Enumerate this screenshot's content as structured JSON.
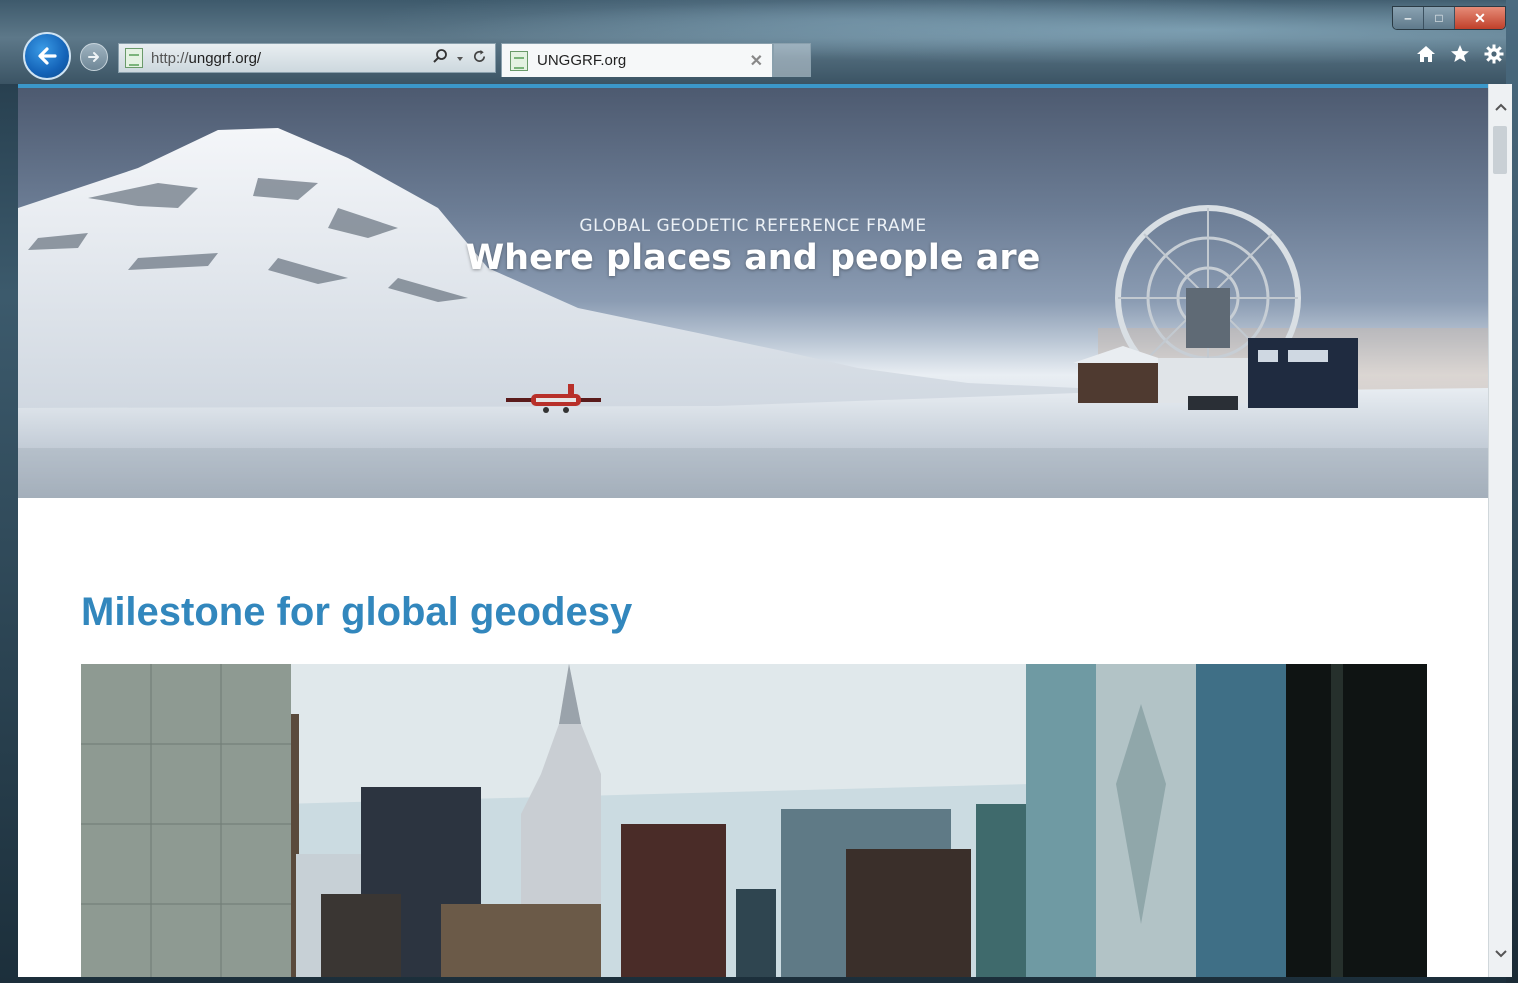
{
  "browser": {
    "address_host": "unggrf.org/",
    "address_scheme": "http://",
    "tab_title": "UNGGRF.org",
    "tab_close_glyph": "✕",
    "window_controls": [
      "‒",
      "□",
      "✕"
    ]
  },
  "page": {
    "hero": {
      "kicker": "GLOBAL GEODETIC REFERENCE FRAME",
      "title": "Where places and people are"
    },
    "section_title": "Milestone for global geodesy"
  },
  "icons": {
    "back": "back-arrow-icon",
    "forward": "forward-arrow-icon",
    "search": "search-icon",
    "dropdown": "chevron-down-icon",
    "refresh": "refresh-icon",
    "home": "home-icon",
    "favorites": "star-icon",
    "settings": "gear-icon"
  },
  "colors": {
    "accent": "#3b97c9",
    "heading": "#3287bd",
    "back_button": "#1463b8"
  }
}
